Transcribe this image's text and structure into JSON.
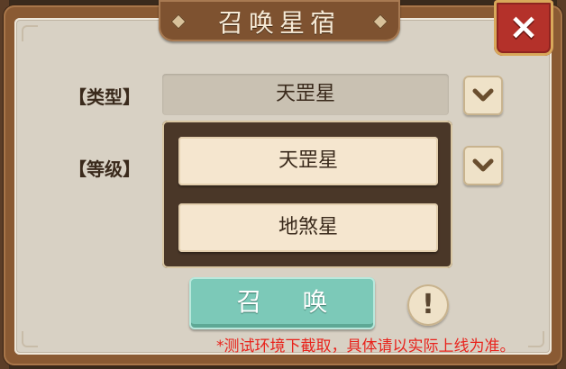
{
  "title": "召唤星宿",
  "close_symbol": "×",
  "type": {
    "label": "【类型】",
    "value": "天罡星"
  },
  "level": {
    "label": "【等级】"
  },
  "dropdown_options": [
    "天罡星",
    "地煞星"
  ],
  "summon_button": "召 唤",
  "info_symbol": "!",
  "notice": "*测试环境下截取，具体请以实际上线为准。",
  "colors": {
    "frame": "#8a5a33",
    "panel": "#d8d1c4",
    "close": "#b4312a",
    "summon": "#7cc9b8",
    "notice": "#e8231c"
  },
  "icons": [
    "close-icon",
    "chevron-down-icon",
    "exclamation-icon"
  ]
}
